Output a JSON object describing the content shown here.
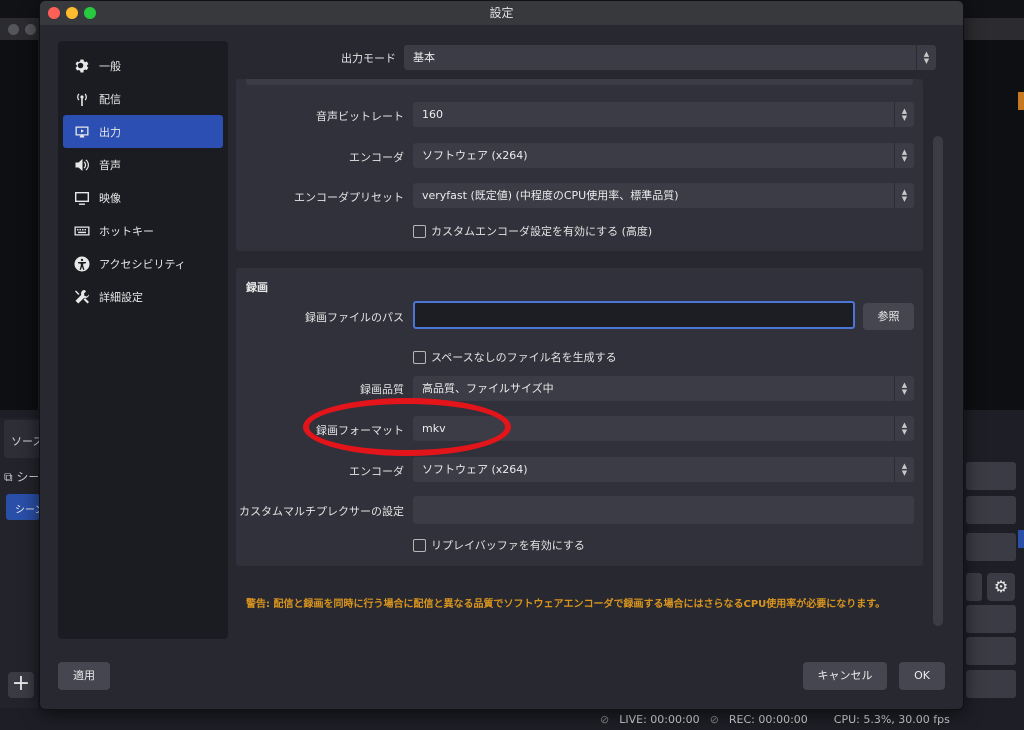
{
  "window_title": "設定",
  "sidebar": {
    "items": [
      {
        "label": "一般",
        "icon": "gear-icon"
      },
      {
        "label": "配信",
        "icon": "broadcast-icon"
      },
      {
        "label": "出力",
        "icon": "output-icon",
        "active": true
      },
      {
        "label": "音声",
        "icon": "speaker-icon"
      },
      {
        "label": "映像",
        "icon": "monitor-icon"
      },
      {
        "label": "ホットキー",
        "icon": "keyboard-icon"
      },
      {
        "label": "アクセシビリティ",
        "icon": "accessibility-icon"
      },
      {
        "label": "詳細設定",
        "icon": "tools-icon"
      }
    ]
  },
  "output_mode": {
    "label": "出力モード",
    "value": "基本"
  },
  "streaming": {
    "audio_bitrate": {
      "label": "音声ビットレート",
      "value": "160"
    },
    "encoder": {
      "label": "エンコーダ",
      "value": "ソフトウェア (x264)"
    },
    "encoder_preset": {
      "label": "エンコーダプリセット",
      "value": "veryfast (既定値) (中程度のCPU使用率、標準品質)"
    },
    "custom_encoder_checkbox": "カスタムエンコーダ設定を有効にする (高度)"
  },
  "recording": {
    "title": "録画",
    "path": {
      "label": "録画ファイルのパス",
      "value": "",
      "browse_label": "参照"
    },
    "no_space_checkbox": "スペースなしのファイル名を生成する",
    "quality": {
      "label": "録画品質",
      "value": "高品質、ファイルサイズ中"
    },
    "format": {
      "label": "録画フォーマット",
      "value": "mkv"
    },
    "encoder": {
      "label": "エンコーダ",
      "value": "ソフトウェア (x264)"
    },
    "muxer": {
      "label": "カスタムマルチプレクサーの設定",
      "value": ""
    },
    "replay_buffer_checkbox": "リプレイバッファを有効にする"
  },
  "warning_text": "警告: 配信と録画を同時に行う場合に配信と異なる品質でソフトウェアエンコーダで録画する場合にはさらなるCPU使用率が必要になります。",
  "buttons": {
    "apply": "適用",
    "cancel": "キャンセル",
    "ok": "OK"
  },
  "background": {
    "sources_label": "ソース",
    "scene_label": "シーン",
    "scene_selected": "シーン"
  },
  "statusbar": {
    "live": "LIVE: 00:00:00",
    "rec": "REC: 00:00:00",
    "cpu": "CPU: 5.3%, 30.00 fps"
  },
  "colors": {
    "accent": "#2c4fb4",
    "warning": "#d9941e",
    "highlight_ring": "#e4141b"
  }
}
